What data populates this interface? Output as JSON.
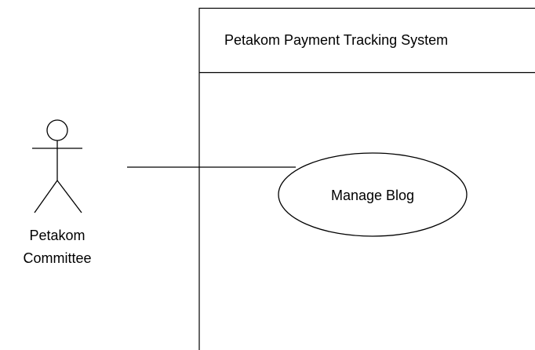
{
  "diagram": {
    "system_boundary": {
      "title": "Petakom Payment Tracking System"
    },
    "actor": {
      "name_line1": "Petakom",
      "name_line2": "Committee"
    },
    "use_case": {
      "label": "Manage Blog"
    },
    "colors": {
      "stroke": "#000000",
      "fill": "#ffffff",
      "text": "#000000"
    }
  }
}
